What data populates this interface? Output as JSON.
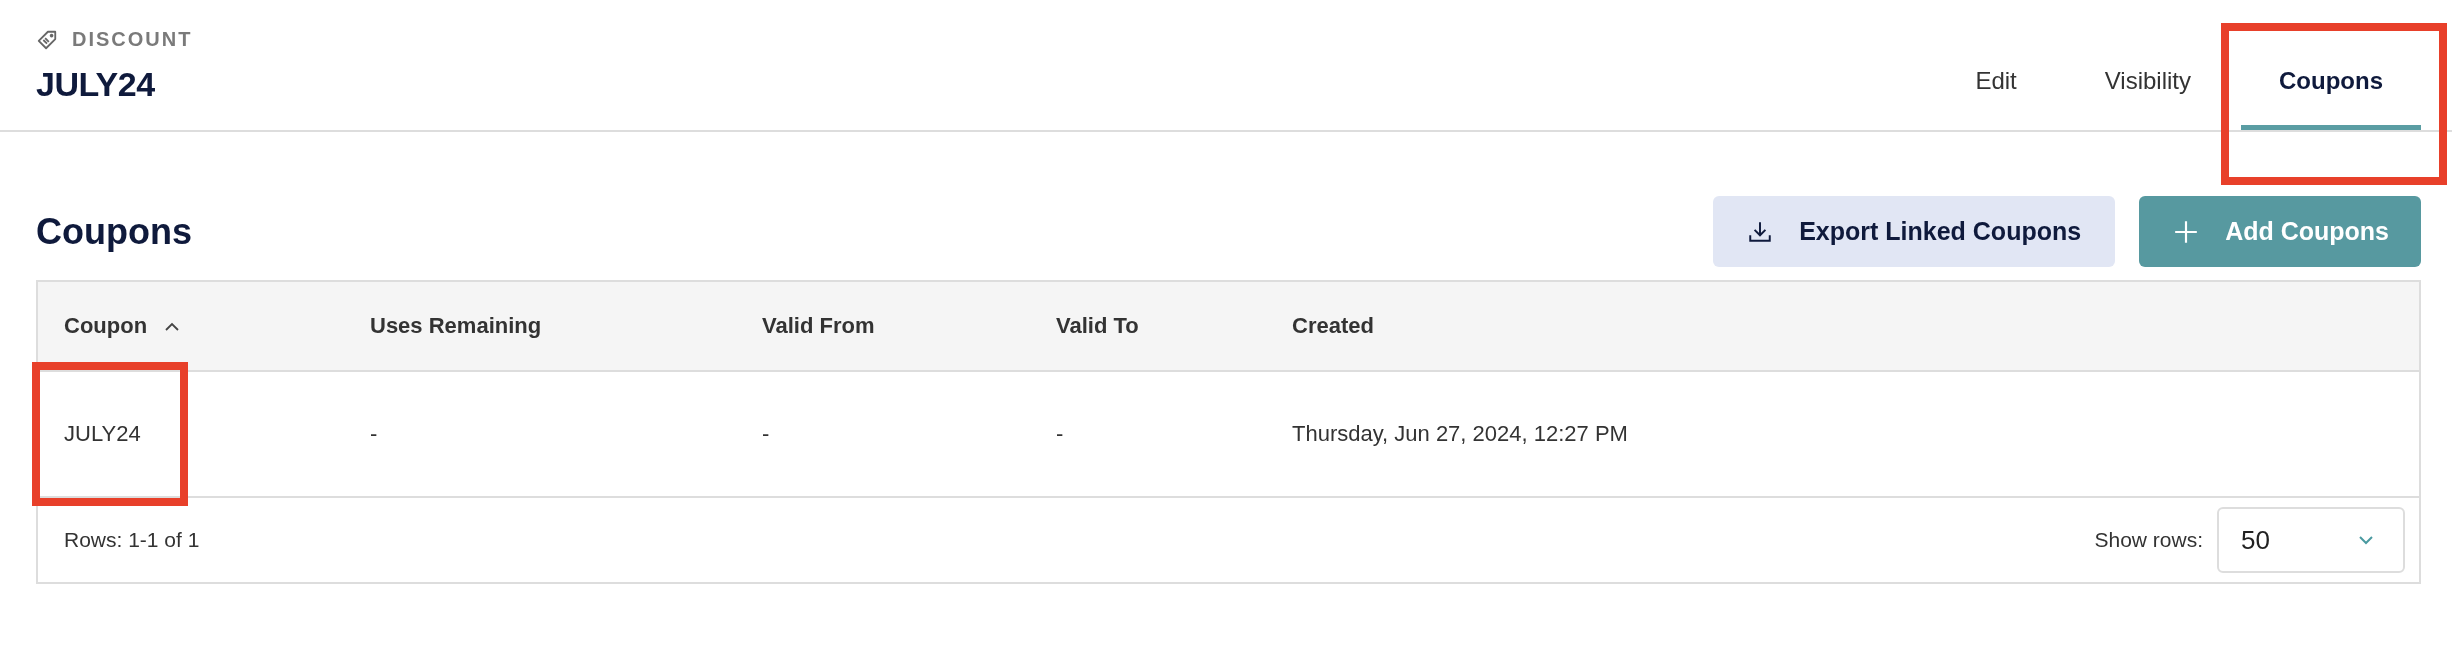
{
  "header": {
    "section_label": "DISCOUNT",
    "title": "JULY24"
  },
  "tabs": [
    {
      "label": "Edit",
      "selected": false,
      "highlighted": false
    },
    {
      "label": "Visibility",
      "selected": false,
      "highlighted": false
    },
    {
      "label": "Coupons",
      "selected": true,
      "highlighted": true
    }
  ],
  "section": {
    "title": "Coupons",
    "buttons": [
      {
        "label": "Export Linked Coupons",
        "kind": "export"
      },
      {
        "label": "Add Coupons",
        "kind": "add"
      }
    ]
  },
  "table": {
    "columns": [
      {
        "label": "Coupon",
        "sorted": true
      },
      {
        "label": "Uses Remaining",
        "sorted": false
      },
      {
        "label": "Valid From",
        "sorted": false
      },
      {
        "label": "Valid To",
        "sorted": false
      },
      {
        "label": "Created",
        "sorted": false
      }
    ],
    "rows": [
      {
        "cells": [
          {
            "text": "JULY24",
            "highlighted": true
          },
          {
            "text": "-",
            "highlighted": false
          },
          {
            "text": "-",
            "highlighted": false
          },
          {
            "text": "-",
            "highlighted": false
          },
          {
            "text": "Thursday, Jun 27, 2024, 12:27 PM",
            "highlighted": false
          }
        ]
      }
    ],
    "footer": {
      "rows_info": "Rows: 1-1 of 1",
      "show_rows_label": "Show rows:",
      "show_rows_value": "50"
    }
  }
}
